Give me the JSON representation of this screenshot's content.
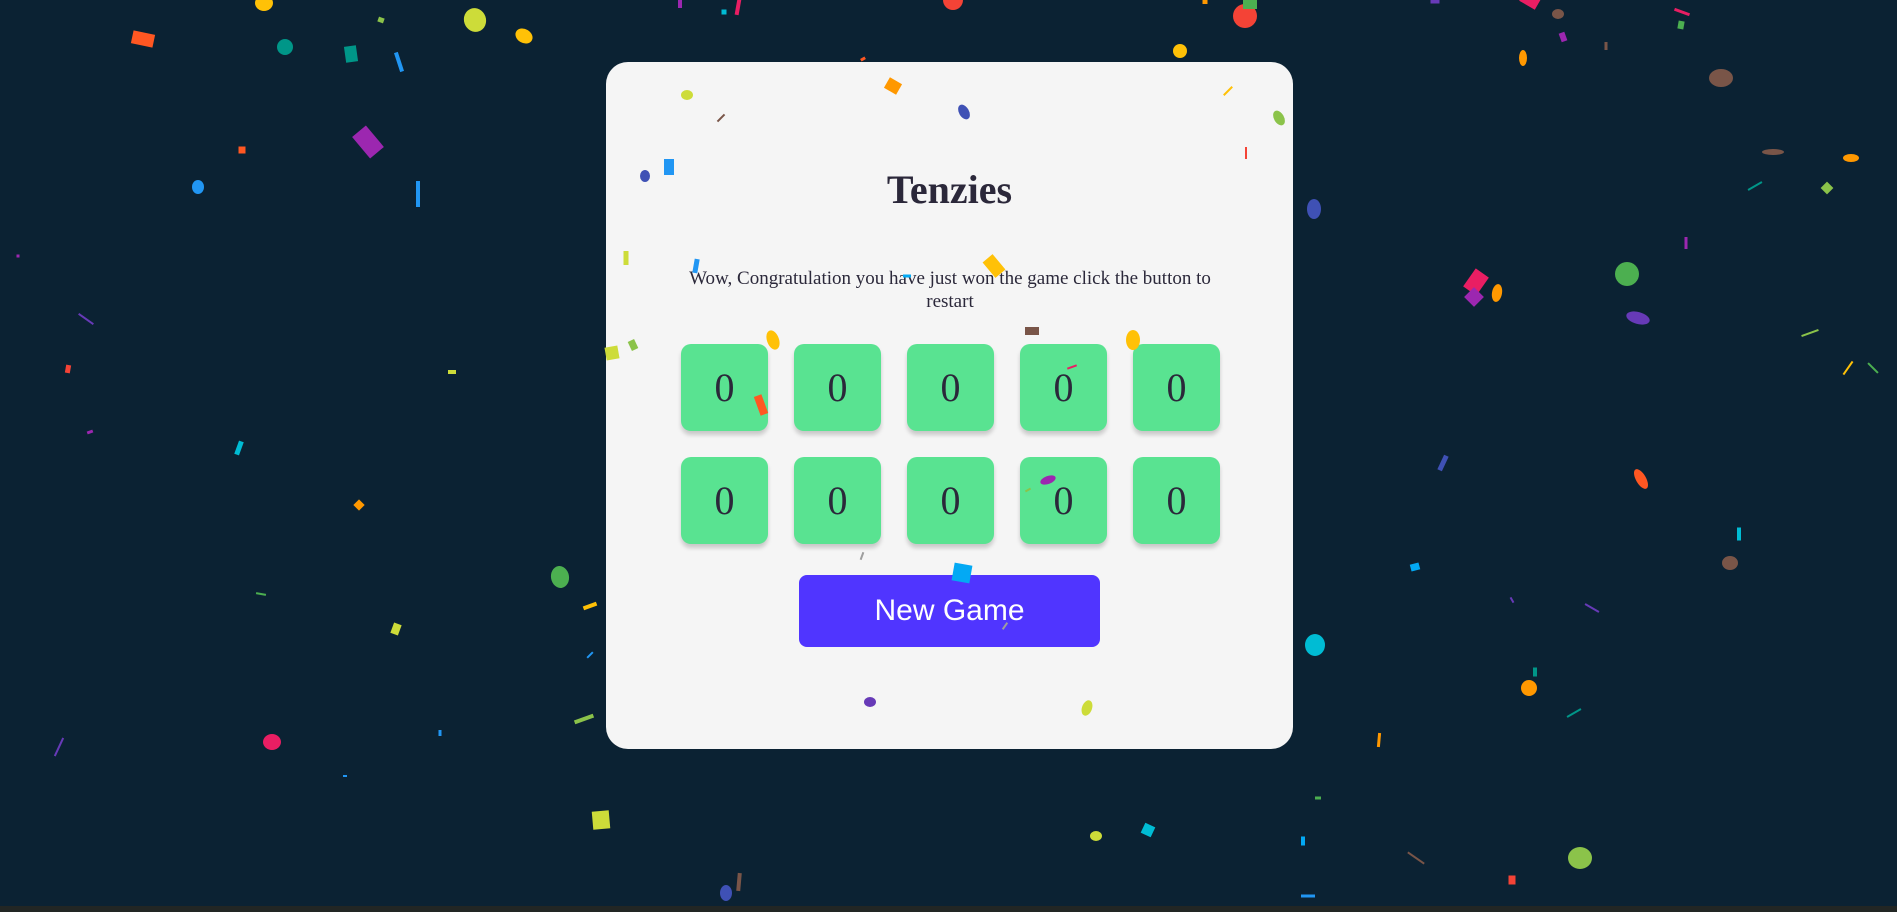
{
  "game": {
    "title": "Tenzies",
    "instructions": "Wow, Congratulation you have just won the game click the button to restart",
    "dice": [
      "0",
      "0",
      "0",
      "0",
      "0",
      "0",
      "0",
      "0",
      "0",
      "0"
    ],
    "button_label": "New Game"
  },
  "colors": {
    "background": "#0b2233",
    "card": "#f5f5f5",
    "die_held": "#59e391",
    "button": "#5035ff",
    "text": "#2b283a"
  },
  "confetti": {
    "active": true,
    "palette": [
      "#f44336",
      "#e91e63",
      "#9c27b0",
      "#673ab7",
      "#3f51b5",
      "#2196f3",
      "#03a9f4",
      "#00bcd4",
      "#009688",
      "#4caf50",
      "#8bc34a",
      "#cddc39",
      "#ffeb3b",
      "#ffc107",
      "#ff9800",
      "#ff5722",
      "#795548"
    ]
  }
}
